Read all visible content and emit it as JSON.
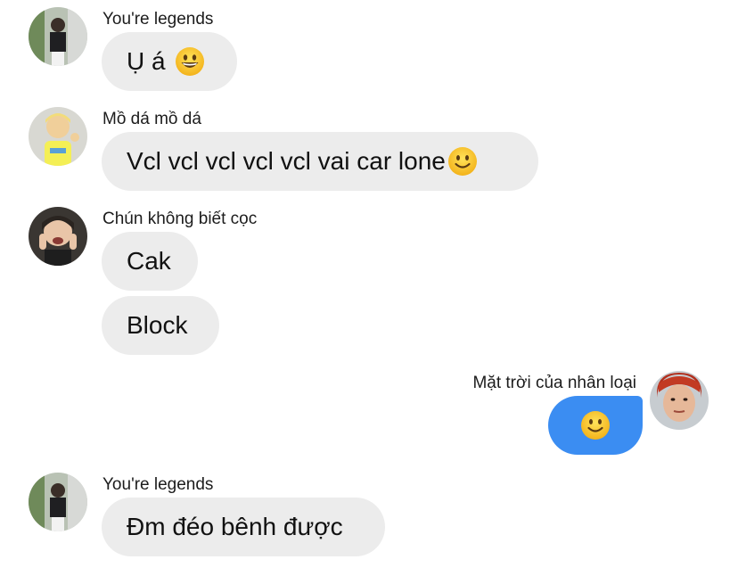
{
  "messages": [
    {
      "sender": "You're legends",
      "bubbles": [
        {
          "text": "Ụ á",
          "emoji": "grinning-face-emoji"
        }
      ]
    },
    {
      "sender": "Mồ dá mồ dá",
      "bubbles": [
        {
          "text": "Vcl vcl vcl vcl vcl vai car lone",
          "emoji": "slightly-smiling-face-emoji"
        }
      ]
    },
    {
      "sender": "Chún không biết cọc",
      "bubbles": [
        {
          "text": "Cak"
        },
        {
          "text": "Block"
        }
      ]
    },
    {
      "sender": "Mặt trời của nhân loại",
      "outgoing": true,
      "bubbles": [
        {
          "text": "",
          "emoji": "slightly-smiling-face-emoji"
        }
      ]
    },
    {
      "sender": "You're legends",
      "bubbles": [
        {
          "text": "Đm đéo bênh được"
        }
      ]
    }
  ],
  "colors": {
    "incoming_bubble": "#ececec",
    "outgoing_bubble": "#3b8df2",
    "sender_text": "#1c1c1c"
  }
}
